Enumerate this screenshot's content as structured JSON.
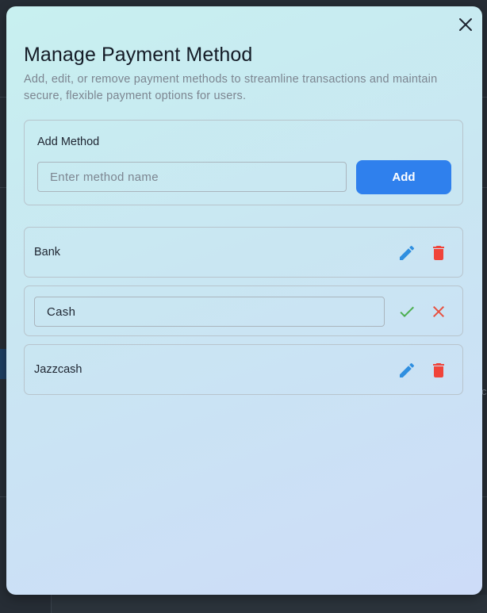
{
  "modal": {
    "title": "Manage Payment Method",
    "subtitle": "Add, edit, or remove payment methods to streamline transactions and maintain secure, flexible payment options for users.",
    "close_icon": "close-icon"
  },
  "add_method": {
    "label": "Add Method",
    "input_placeholder": "Enter method name",
    "input_value": "",
    "button_label": "Add"
  },
  "methods": [
    {
      "name": "Bank",
      "mode": "view",
      "actions": [
        "edit-icon",
        "delete-icon"
      ]
    },
    {
      "name": "Cash",
      "mode": "edit",
      "actions": [
        "check-icon",
        "cancel-icon"
      ]
    },
    {
      "name": "Jazzcash",
      "mode": "view",
      "actions": [
        "edit-icon",
        "delete-icon"
      ]
    }
  ],
  "colors": {
    "primary": "#2f80ed",
    "edit": "#2f8fe0",
    "delete": "#f0443a",
    "confirm": "#4caf50",
    "cancel": "#e8503f"
  }
}
